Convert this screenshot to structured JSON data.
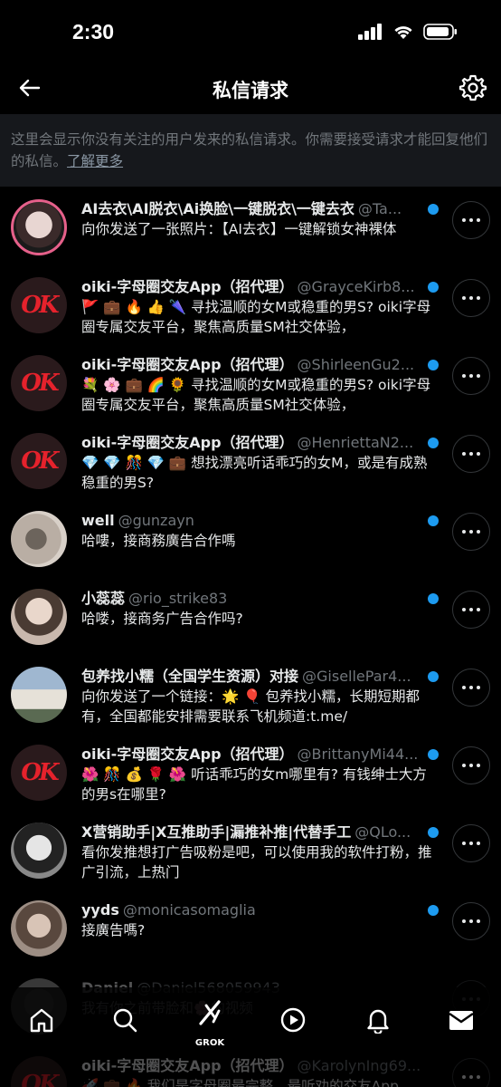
{
  "status_bar": {
    "time": "2:30"
  },
  "header": {
    "title": "私信请求"
  },
  "info": {
    "text": "这里会显示你没有关注的用户发来的私信请求。你需要接受请求才能回复他们的私信。",
    "link": "了解更多"
  },
  "requests": [
    {
      "name": "AI去衣\\AI脱衣\\Ai换脸\\一键脱衣\\一键去衣",
      "handle": "@Ta...",
      "message": "向你发送了一张照片：【AI去衣】一键解锁女神裸体",
      "avatar": "photo-pink"
    },
    {
      "name": "oiki-字母圈交友App（招代理）",
      "handle": "@GrayceKirb8...",
      "message": "🚩 💼 🔥 👍 🌂 寻找温顺的女M或稳重的男S? oiki字母圈专属交友平台，聚焦高质量SM社交体验，",
      "avatar": "ok"
    },
    {
      "name": "oiki-字母圈交友App（招代理）",
      "handle": "@ShirleenGu2...",
      "message": "💐 🌸 💼 🌈 🌻 寻找温顺的女M或稳重的男S? oiki字母圈专属交友平台，聚焦高质量SM社交体验，",
      "avatar": "ok"
    },
    {
      "name": "oiki-字母圈交友App（招代理）",
      "handle": "@HenriettaN2...",
      "message": "💎 💎 🎊 💎 💼 想找漂亮听话乖巧的女M，或是有成熟稳重的男S?",
      "avatar": "ok"
    },
    {
      "name": "well",
      "handle": "@gunzayn",
      "message": "哈嘍，接商務廣告合作嗎",
      "avatar": "photo-tattoo"
    },
    {
      "name": "小蕊蕊",
      "handle": "@rio_strike83",
      "message": "哈喽，接商务广告合作吗?",
      "avatar": "photo-girl"
    },
    {
      "name": "包养找小糯（全国学生资源）对接",
      "handle": "@GisellePar4...",
      "message": "向你发送了一个链接：🌟 🎈 包养找小糯，长期短期都有，全国都能安排需要联系飞机频道:t.me/",
      "avatar": "photo-house"
    },
    {
      "name": "oiki-字母圈交友App（招代理）",
      "handle": "@BrittanyMi44...",
      "message": "🌺 🎊 💰 🌹 🌺 听话乖巧的女m哪里有? 有钱绅士大方的男s在哪里?",
      "avatar": "ok"
    },
    {
      "name": "X营销助手|X互推助手|漏推补推|代替手工",
      "handle": "@QLo...",
      "message": "看你发推想打广告吸粉是吧，可以使用我的软件打粉，推广引流，上热门",
      "avatar": "photo-bw"
    },
    {
      "name": "yyds",
      "handle": "@monicasomaglia",
      "message": "接廣告嗎?",
      "avatar": "photo-selfie"
    },
    {
      "name": "Daniel",
      "handle": "@Daniel568059943",
      "message": "我有你之前带脸和🌸的视频",
      "avatar": "photo-grey"
    },
    {
      "name": "oiki-字母圈交友App（招代理）",
      "handle": "@KarolynIng69...",
      "message": "🚀 💼 🔥 我们是字母圈最完整、最听劝的交友App，",
      "avatar": "ok"
    }
  ],
  "nav": {
    "items": [
      "home-icon",
      "search-icon",
      "grok-icon",
      "video-icon",
      "bell-icon",
      "mail-icon"
    ],
    "grok_label": "GROK"
  },
  "colors": {
    "unread_dot": "#1d9bf0",
    "background": "#000000",
    "info_bg": "#16181c"
  }
}
